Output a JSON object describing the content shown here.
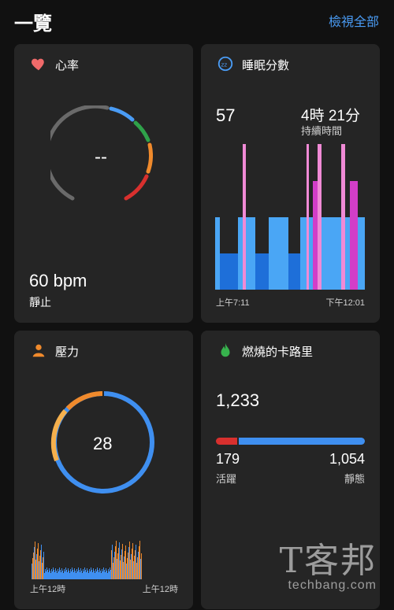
{
  "header": {
    "title": "一覽",
    "view_all": "檢視全部"
  },
  "heart_rate": {
    "title": "心率",
    "current": "--",
    "value": "60 bpm",
    "status": "靜止",
    "icon": "heart-icon",
    "color": "#e05a5a"
  },
  "sleep": {
    "title": "睡眠分數",
    "score": "57",
    "duration": "4時 21分",
    "duration_label": "持續時間",
    "start_time": "上午7:11",
    "end_time": "下午12:01",
    "icon": "sleep-icon",
    "colors": {
      "deep": "#1e6fd9",
      "light": "#4aa6f5",
      "rem": "#d23ec8",
      "awake": "#f08ad6"
    }
  },
  "stress": {
    "title": "壓力",
    "value": "28",
    "start_time": "上午12時",
    "end_time": "上午12時",
    "icon": "stress-icon",
    "colors": {
      "rest": "#3f8ff0",
      "high": "#f08a2c",
      "medium": "#f5b04d"
    }
  },
  "calories": {
    "title": "燃燒的卡路里",
    "total": "1,233",
    "active": "179",
    "active_label": "活躍",
    "resting": "1,054",
    "resting_label": "靜態",
    "active_fraction": 0.145,
    "icon": "flame-icon",
    "colors": {
      "active": "#d8302e",
      "resting": "#3f8ff0"
    }
  },
  "watermark": {
    "cn": "T客邦",
    "en": "techbang.com"
  }
}
